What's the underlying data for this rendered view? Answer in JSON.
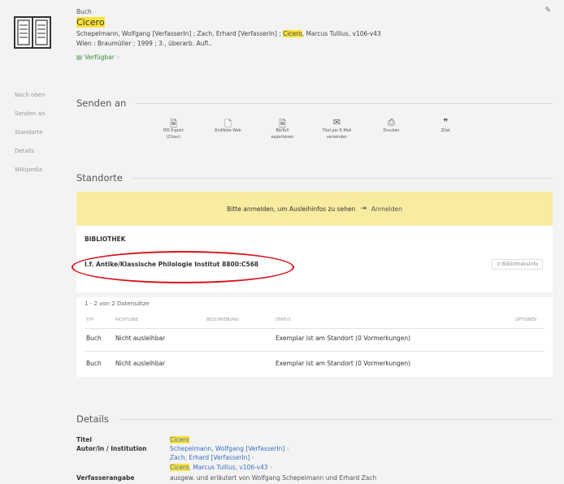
{
  "record": {
    "type": "Buch",
    "title": "Cicero",
    "authors_pre": "Schepelmann, Wolfgang [VerfasserIn] ; Zach, Erhard [VerfasserIn] ; ",
    "authors_hl": "Cicero",
    "authors_post": ", Marcus Tullius, v106-v43",
    "publication": "Wien : Braumüller ; 1999 ; 3., überarb. Aufl..",
    "availability": "Verfügbar",
    "availability_chevron": "›"
  },
  "leftnav": [
    "Nach oben",
    "Senden an",
    "Standorte",
    "Details",
    "Wikipedia"
  ],
  "send": {
    "heading": "Senden an",
    "items": [
      {
        "icon": "ris-export-icon",
        "glyph": "🗎",
        "label1": "RIS Export",
        "label2": "(Citavi)"
      },
      {
        "icon": "endnote-web-icon",
        "glyph": "🗋",
        "label1": "EndNote Web",
        "label2": ""
      },
      {
        "icon": "bibtex-icon",
        "glyph": "🗎",
        "label1": "BibTeX",
        "label2": "exportieren"
      },
      {
        "icon": "email-icon",
        "glyph": "✉",
        "label1": "Titel per E-Mail",
        "label2": "versenden"
      },
      {
        "icon": "print-icon",
        "glyph": "⎙",
        "label1": "Drucken",
        "label2": ""
      },
      {
        "icon": "quote-icon",
        "glyph": "❞",
        "label1": "Zitat",
        "label2": ""
      }
    ]
  },
  "standorte": {
    "heading": "Standorte",
    "login_msg": "Bitte anmelden, um Ausleihinfos zu sehen",
    "login_icon": "⇥",
    "login_link": "Anmelden",
    "library_header": "BIBLIOTHEK",
    "location": "I.f. Antike/Klassische Philologie  Institut  8800:C568",
    "bibinfo": "Bibliotheksinfo",
    "count": "1 - 2 von 2 Datensätze",
    "columns": [
      "TYP",
      "RICHTLINIE",
      "BESCHREIBUNG",
      "STATUS",
      "OPTIONEN"
    ],
    "rows": [
      {
        "typ": "Buch",
        "richtlinie": "Nicht ausleihbar",
        "status": "Exemplar ist am Standort (0 Vormerkungen)"
      },
      {
        "typ": "Buch",
        "richtlinie": "Nicht ausleihbar",
        "status": "Exemplar ist am Standort (0 Vormerkungen)"
      }
    ]
  },
  "details": {
    "heading": "Details",
    "titel_label": "Titel",
    "titel_value": "Cicero",
    "autor_label": "Autor/in / Institution",
    "autor_values": [
      "Schepelmann, Wolfgang [VerfasserIn]",
      "Zach, Erhard [VerfasserIn]"
    ],
    "autor3_hl": "Cicero",
    "autor3_rest": ", Marcus Tullius, v106-v43",
    "chevron": "›",
    "verfasser_label": "Verfasserangabe",
    "verfasser_value": "ausgew. und erläutert von Wolfgang Schepelmann und Erhard Zach"
  },
  "colors": {
    "highlight": "#fbe23b",
    "available": "#3a8a3a",
    "link": "#3a6fc4",
    "annotation": "#d8101a",
    "login_bar": "#f8eca0"
  }
}
